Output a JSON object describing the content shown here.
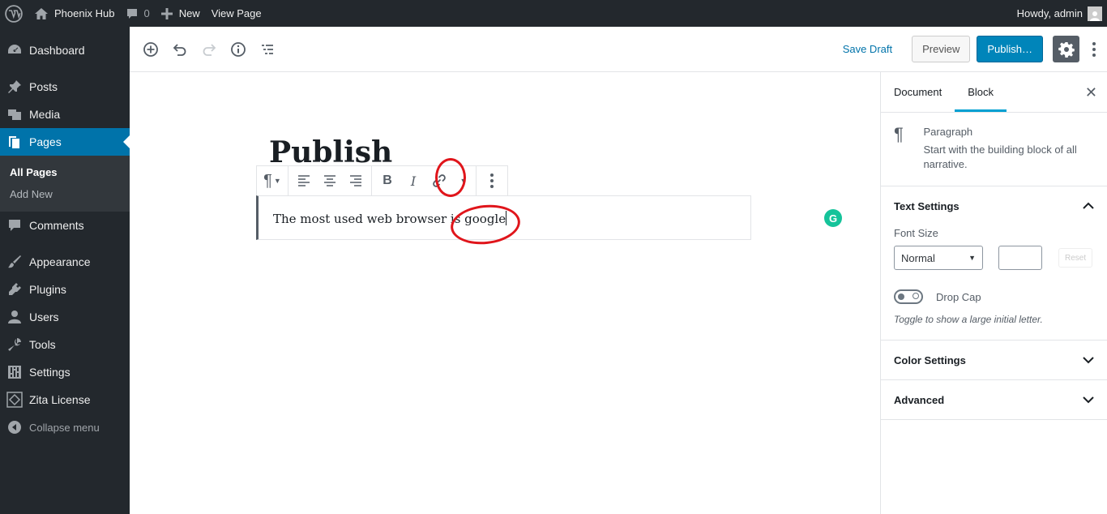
{
  "adminbar": {
    "site_name": "Phoenix Hub",
    "comments_count": "0",
    "new_label": "New",
    "view_page_label": "View Page",
    "greeting": "Howdy, admin"
  },
  "sidebar": {
    "items": [
      {
        "label": "Dashboard",
        "icon": "dashboard-icon"
      },
      {
        "label": "Posts",
        "icon": "pin-icon"
      },
      {
        "label": "Media",
        "icon": "media-icon"
      },
      {
        "label": "Pages",
        "icon": "pages-icon",
        "active": true
      },
      {
        "label": "Comments",
        "icon": "comment-icon"
      },
      {
        "label": "Appearance",
        "icon": "brush-icon"
      },
      {
        "label": "Plugins",
        "icon": "plug-icon"
      },
      {
        "label": "Users",
        "icon": "user-icon"
      },
      {
        "label": "Tools",
        "icon": "wrench-icon"
      },
      {
        "label": "Settings",
        "icon": "sliders-icon"
      },
      {
        "label": "Zita License",
        "icon": "diamond-icon"
      }
    ],
    "submenu": [
      "All Pages",
      "Add New"
    ],
    "collapse_label": "Collapse menu"
  },
  "header": {
    "save_draft": "Save Draft",
    "preview": "Preview",
    "publish": "Publish…"
  },
  "editor": {
    "title": "Publish",
    "paragraph_text": "The most used web browser is google"
  },
  "settings_sidebar": {
    "tabs": [
      "Document",
      "Block"
    ],
    "active_tab": "Block",
    "block_name": "Paragraph",
    "block_description": "Start with the building block of all narrative.",
    "text_settings": {
      "title": "Text Settings",
      "font_size_label": "Font Size",
      "font_size_value": "Normal",
      "reset_label": "Reset",
      "drop_cap_label": "Drop Cap",
      "drop_cap_help": "Toggle to show a large initial letter."
    },
    "color_settings": "Color Settings",
    "advanced": "Advanced"
  },
  "colors": {
    "accent": "#0073aa",
    "publish_button": "#0085ba",
    "annotation_red": "#e0151b",
    "grammarly_green": "#15c39a"
  }
}
